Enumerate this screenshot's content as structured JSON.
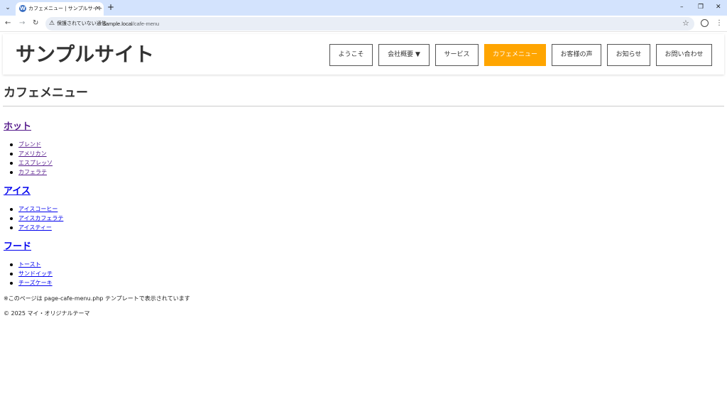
{
  "browser": {
    "tab_title": "カフェメニュー | サンプルサイト",
    "tab_close": "✕",
    "new_tab": "+",
    "security_label": "保護されていない通信",
    "url_host": "sample.local",
    "url_path": "/cafe-menu",
    "window_controls": [
      "–",
      "❐",
      "✕"
    ]
  },
  "site": {
    "title": "サンプルサイト"
  },
  "nav": {
    "items": [
      {
        "label": "ようこそ",
        "active": false
      },
      {
        "label": "会社概要 ▼",
        "active": false
      },
      {
        "label": "サービス",
        "active": false
      },
      {
        "label": "カフェメニュー",
        "active": true
      },
      {
        "label": "お客様の声",
        "active": false
      },
      {
        "label": "お知らせ",
        "active": false
      },
      {
        "label": "お問い合わせ",
        "active": false
      }
    ],
    "active_color": "#ffa500"
  },
  "page": {
    "heading": "カフェメニュー",
    "sections": [
      {
        "heading": "ホット",
        "items": [
          "ブレンド",
          "アメリカン",
          "エスプレッソ",
          "カフェラテ"
        ]
      },
      {
        "heading": "アイス",
        "items": [
          "アイスコーヒー",
          "アイスカフェラテ",
          "アイスティー"
        ]
      },
      {
        "heading": "フード",
        "items": [
          "トースト",
          "サンドイッチ",
          "チーズケーキ"
        ]
      }
    ],
    "template_note": "※このページは page-cafe-menu.php テンプレートで表示されています"
  },
  "footer": {
    "copyright": "© 2025 マイ・オリジナルテーマ"
  },
  "colors": {
    "visited_link": "#551a8b",
    "unvisited_link": "#0000ee",
    "tabbar": "#d3e3fd"
  }
}
